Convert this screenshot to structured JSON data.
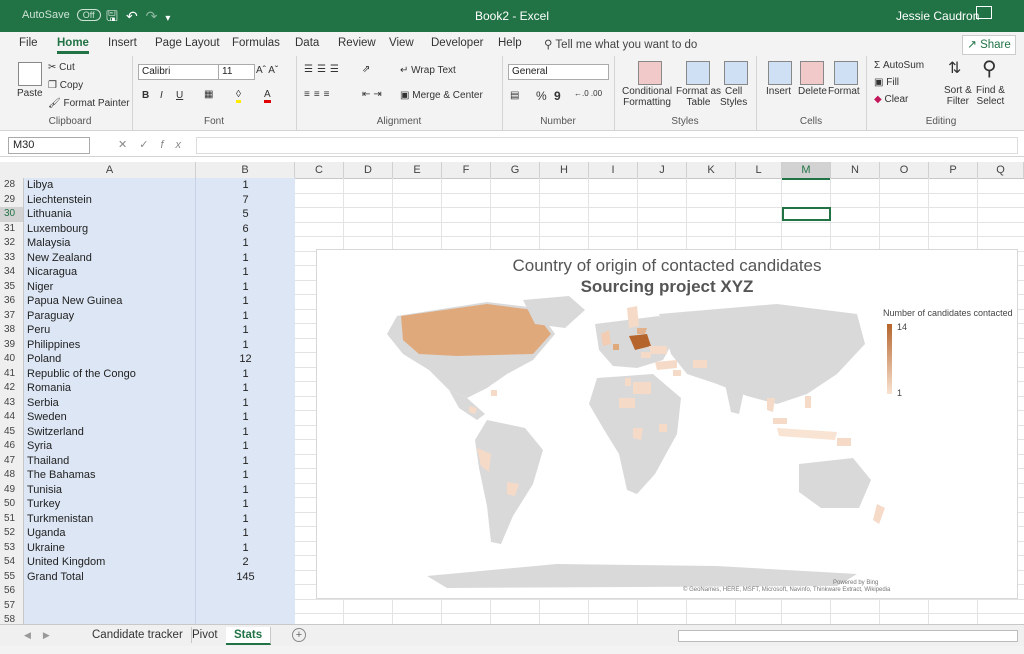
{
  "titlebar": {
    "autosave_label": "AutoSave",
    "autosave_state": "Off",
    "document_title": "Book2  -  Excel",
    "user_name": "Jessie Caudron"
  },
  "ribbon_tabs": [
    "File",
    "Home",
    "Insert",
    "Page Layout",
    "Formulas",
    "Data",
    "Review",
    "View",
    "Developer",
    "Help"
  ],
  "active_tab": "Home",
  "tell_me": "Tell me what you want to do",
  "share_label": "Share",
  "ribbon": {
    "clipboard": {
      "paste": "Paste",
      "cut": "Cut",
      "copy": "Copy",
      "format_painter": "Format Painter",
      "label": "Clipboard"
    },
    "font": {
      "name": "Calibri",
      "size": "11",
      "bold": "B",
      "italic": "I",
      "underline": "U",
      "label": "Font"
    },
    "alignment": {
      "wrap_text": "Wrap Text",
      "merge_center": "Merge & Center",
      "label": "Alignment"
    },
    "number": {
      "format": "General",
      "percent": "%",
      "comma": "9",
      "label": "Number"
    },
    "styles": {
      "conditional": "Conditional",
      "conditional2": "Formatting",
      "format_as": "Format as",
      "format_as2": "Table",
      "cell": "Cell",
      "cell2": "Styles",
      "label": "Styles"
    },
    "cells": {
      "insert": "Insert",
      "delete": "Delete",
      "format": "Format",
      "label": "Cells"
    },
    "editing": {
      "autosum": "AutoSum",
      "fill": "Fill",
      "clear": "Clear",
      "sort": "Sort &",
      "sort2": "Filter",
      "find": "Find &",
      "find2": "Select",
      "label": "Editing"
    }
  },
  "formula_bar": {
    "name_box": "M30",
    "formula": ""
  },
  "columns": [
    "A",
    "B",
    "C",
    "D",
    "E",
    "F",
    "G",
    "H",
    "I",
    "J",
    "K",
    "L",
    "M",
    "N",
    "O",
    "P",
    "Q"
  ],
  "selected_column": "M",
  "selected_row": "30",
  "rows": [
    {
      "n": "28",
      "a": "Libya",
      "b": "1"
    },
    {
      "n": "29",
      "a": "Liechtenstein",
      "b": "7"
    },
    {
      "n": "30",
      "a": "Lithuania",
      "b": "5"
    },
    {
      "n": "31",
      "a": "Luxembourg",
      "b": "6"
    },
    {
      "n": "32",
      "a": "Malaysia",
      "b": "1"
    },
    {
      "n": "33",
      "a": "New Zealand",
      "b": "1"
    },
    {
      "n": "34",
      "a": "Nicaragua",
      "b": "1"
    },
    {
      "n": "35",
      "a": "Niger",
      "b": "1"
    },
    {
      "n": "36",
      "a": "Papua New Guinea",
      "b": "1"
    },
    {
      "n": "37",
      "a": "Paraguay",
      "b": "1"
    },
    {
      "n": "38",
      "a": "Peru",
      "b": "1"
    },
    {
      "n": "39",
      "a": "Philippines",
      "b": "1"
    },
    {
      "n": "40",
      "a": "Poland",
      "b": "12"
    },
    {
      "n": "41",
      "a": "Republic of the Congo",
      "b": "1"
    },
    {
      "n": "42",
      "a": "Romania",
      "b": "1"
    },
    {
      "n": "43",
      "a": "Serbia",
      "b": "1"
    },
    {
      "n": "44",
      "a": "Sweden",
      "b": "1"
    },
    {
      "n": "45",
      "a": "Switzerland",
      "b": "1"
    },
    {
      "n": "46",
      "a": "Syria",
      "b": "1"
    },
    {
      "n": "47",
      "a": "Thailand",
      "b": "1"
    },
    {
      "n": "48",
      "a": "The Bahamas",
      "b": "1"
    },
    {
      "n": "49",
      "a": "Tunisia",
      "b": "1"
    },
    {
      "n": "50",
      "a": "Turkey",
      "b": "1"
    },
    {
      "n": "51",
      "a": "Turkmenistan",
      "b": "1"
    },
    {
      "n": "52",
      "a": "Uganda",
      "b": "1"
    },
    {
      "n": "53",
      "a": "Ukraine",
      "b": "1"
    },
    {
      "n": "54",
      "a": "United Kingdom",
      "b": "2"
    },
    {
      "n": "55",
      "a": "Grand Total",
      "b": "145"
    },
    {
      "n": "56",
      "a": "",
      "b": ""
    },
    {
      "n": "57",
      "a": "",
      "b": ""
    },
    {
      "n": "58",
      "a": "",
      "b": ""
    }
  ],
  "chart": {
    "title": "Country of origin of contacted candidates",
    "subtitle": "Sourcing project XYZ",
    "legend_title": "Number of candidates contacted",
    "legend_max": "14",
    "legend_min": "1",
    "credit_powered": "Powered by Bing",
    "credit_sources": "© GeoNames, HERE, MSFT, Microsoft, Navinfo, Thinkware Extract, Wikipedia",
    "land_color": "#d9d9d9",
    "max_color": "#b5642b",
    "min_color": "#f9e3d2"
  },
  "sheet_tabs": [
    "Candidate tracker",
    "Pivot",
    "Stats"
  ],
  "active_sheet": "Stats",
  "colors": {
    "excel_green": "#217346",
    "selection_blue": "#dce6f4"
  }
}
